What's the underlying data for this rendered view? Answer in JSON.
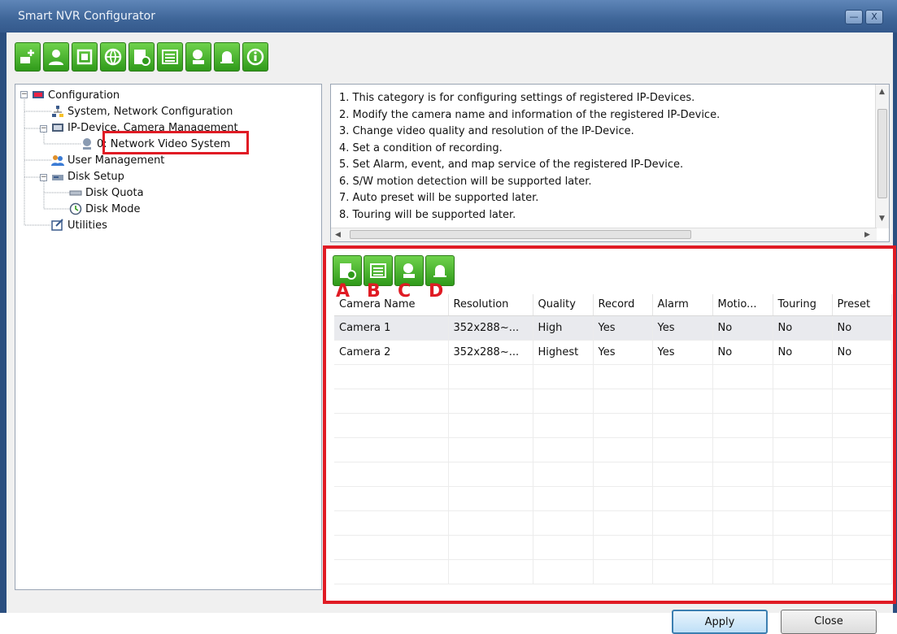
{
  "window": {
    "title": "Smart NVR Configurator",
    "minimize": "—",
    "close": "X"
  },
  "toolbar": {
    "icons": [
      "add-device-icon",
      "user-icon",
      "window-icon",
      "globe-icon",
      "disk-settings-icon",
      "keypad-icon",
      "camera-record-icon",
      "bell-icon",
      "info-icon"
    ]
  },
  "tree": {
    "root": "Configuration",
    "items": [
      {
        "label": "System, Network Configuration"
      },
      {
        "label": "IP-Device, Camera Management"
      },
      {
        "label": "0: Network Video System"
      },
      {
        "label": "User Management"
      },
      {
        "label": "Disk Setup"
      },
      {
        "label": "Disk Quota"
      },
      {
        "label": "Disk Mode"
      },
      {
        "label": "Utilities"
      }
    ]
  },
  "info": {
    "lines": [
      "1. This category is for configuring settings of registered IP-Devices.",
      "2. Modify the camera name and information of the registered IP-Device.",
      "3. Change video quality and resolution of the IP-Device.",
      "4. Set a condition of recording.",
      "5. Set Alarm, event, and map service of the registered IP-Device.",
      "6. S/W motion detection will be supported later.",
      "7. Auto preset will be supported later.",
      "8. Touring will be supported later."
    ]
  },
  "camera_panel": {
    "labels": [
      "A",
      "B",
      "C",
      "D"
    ],
    "columns": [
      "Camera Name",
      "Resolution",
      "Quality",
      "Record",
      "Alarm",
      "Motio...",
      "Touring",
      "Preset"
    ],
    "rows": [
      [
        "Camera 1",
        "352x288~...",
        "High",
        "Yes",
        "Yes",
        "No",
        "No",
        "No"
      ],
      [
        "Camera 2",
        "352x288~...",
        "Highest",
        "Yes",
        "Yes",
        "No",
        "No",
        "No"
      ]
    ]
  },
  "buttons": {
    "apply": "Apply",
    "close": "Close"
  },
  "colors": {
    "accent_highlight": "#e01b24",
    "toolbar_green": "#3aa820",
    "title_blue": "#3e6598"
  }
}
